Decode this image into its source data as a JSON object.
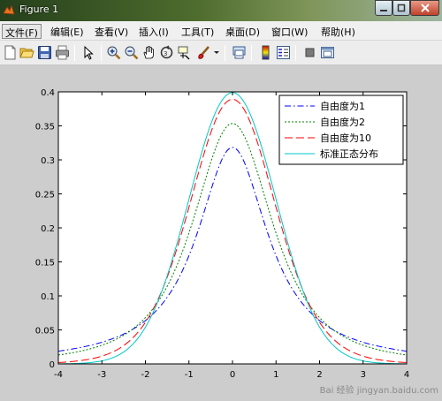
{
  "window": {
    "title": "Figure 1"
  },
  "menu": [
    {
      "label": "文件(F)",
      "active": true
    },
    {
      "label": "编辑(E)"
    },
    {
      "label": "查看(V)"
    },
    {
      "label": "插入(I)"
    },
    {
      "label": "工具(T)"
    },
    {
      "label": "桌面(D)"
    },
    {
      "label": "窗口(W)"
    },
    {
      "label": "帮助(H)"
    }
  ],
  "toolbar_icons": [
    "new-figure-icon",
    "open-file-icon",
    "save-icon",
    "print-icon",
    "arrow-select-icon",
    "zoom-in-icon",
    "zoom-out-icon",
    "pan-hand-icon",
    "rotate-3d-icon",
    "data-cursor-icon",
    "brush-icon",
    "link-plot-icon",
    "colorbar-icon",
    "legend-icon",
    "hide-plot-tools-icon",
    "show-plot-tools-icon"
  ],
  "chart_data": {
    "type": "line",
    "xlim": [
      -4,
      4
    ],
    "ylim": [
      0,
      0.4
    ],
    "xticks": [
      "-4",
      "-3",
      "-2",
      "-1",
      "0",
      "1",
      "2",
      "3",
      "4"
    ],
    "yticks": [
      "0",
      "0.05",
      "0.1",
      "0.15",
      "0.2",
      "0.25",
      "0.3",
      "0.35",
      "0.4"
    ],
    "legend_position": "top-right",
    "series": [
      {
        "name": "自由度为1",
        "color": "#0000ff",
        "dash": "dashdot",
        "dof": 1,
        "x": [
          -4,
          -3.5,
          -3,
          -2.5,
          -2,
          -1.5,
          -1,
          -0.5,
          0,
          0.5,
          1,
          1.5,
          2,
          2.5,
          3,
          3.5,
          4
        ],
        "y": [
          0.019,
          0.024,
          0.032,
          0.044,
          0.064,
          0.098,
          0.159,
          0.255,
          0.318,
          0.255,
          0.159,
          0.098,
          0.064,
          0.044,
          0.032,
          0.024,
          0.019
        ]
      },
      {
        "name": "自由度为2",
        "color": "#008000",
        "dash": "dotted",
        "dof": 2,
        "x": [
          -4,
          -3.5,
          -3,
          -2.5,
          -2,
          -1.5,
          -1,
          -0.5,
          0,
          0.5,
          1,
          1.5,
          2,
          2.5,
          3,
          3.5,
          4
        ],
        "y": [
          0.013,
          0.018,
          0.027,
          0.041,
          0.068,
          0.115,
          0.192,
          0.295,
          0.354,
          0.295,
          0.192,
          0.115,
          0.068,
          0.041,
          0.027,
          0.018,
          0.013
        ]
      },
      {
        "name": "自由度为10",
        "color": "#ff0000",
        "dash": "dashed",
        "dof": 10,
        "x": [
          -4,
          -3.5,
          -3,
          -2.5,
          -2,
          -1.5,
          -1,
          -0.5,
          0,
          0.5,
          1,
          1.5,
          2,
          2.5,
          3,
          3.5,
          4
        ],
        "y": [
          0.002,
          0.005,
          0.011,
          0.025,
          0.061,
          0.127,
          0.23,
          0.34,
          0.389,
          0.34,
          0.23,
          0.127,
          0.061,
          0.025,
          0.011,
          0.005,
          0.002
        ]
      },
      {
        "name": "标准正态分布",
        "color": "#00c8c8",
        "dash": "solid",
        "dof": 0,
        "x": [
          -4,
          -3.5,
          -3,
          -2.5,
          -2,
          -1.5,
          -1,
          -0.5,
          0,
          0.5,
          1,
          1.5,
          2,
          2.5,
          3,
          3.5,
          4
        ],
        "y": [
          0.0001,
          0.0009,
          0.0044,
          0.0175,
          0.054,
          0.1295,
          0.242,
          0.352,
          0.399,
          0.352,
          0.242,
          0.1295,
          0.054,
          0.0175,
          0.0044,
          0.0009,
          0.0001
        ]
      }
    ]
  },
  "watermark": "Bai 经验 jingyan.baidu.com"
}
